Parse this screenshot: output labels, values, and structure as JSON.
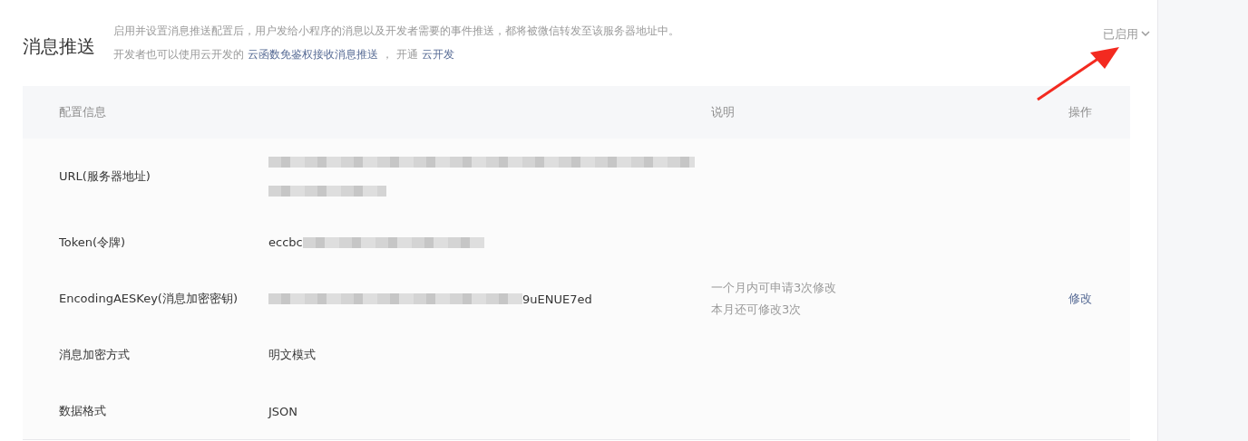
{
  "header": {
    "title": "消息推送",
    "description_line_1": "启用并设置消息推送配置后，用户发给小程序的消息以及开发者需要的事件推送，都将被微信转发至该服务器地址中。",
    "description_line_2": [
      {
        "kind": "text",
        "text": "开发者也可以使用云开发的"
      },
      {
        "kind": "link",
        "text": "云函数免鉴权接收消息推送"
      },
      {
        "kind": "text",
        "text": "， 开通"
      },
      {
        "kind": "link",
        "text": "云开发"
      }
    ],
    "status": "已启用"
  },
  "table": {
    "columns": [
      "配置信息",
      "说明",
      "操作"
    ],
    "rows": [
      {
        "label": "URL(服务器地址)",
        "value": [
          {
            "kind": "blur"
          },
          {
            "kind": "break"
          },
          {
            "kind": "blur"
          }
        ]
      },
      {
        "label": "Token(令牌)",
        "value": [
          {
            "kind": "text",
            "text": "eccbc"
          },
          {
            "kind": "blur"
          }
        ]
      },
      {
        "label": "EncodingAESKey(消息加密密钥)",
        "value": [
          {
            "kind": "blur"
          },
          {
            "kind": "text",
            "text": "9uENUE7ed"
          }
        ],
        "note": [
          "一个月内可申请3次修改",
          "本月还可修改3次"
        ],
        "action": "修改"
      },
      {
        "label": "消息加密方式",
        "value": [
          {
            "kind": "text",
            "text": "明文模式"
          }
        ]
      },
      {
        "label": "数据格式",
        "value": [
          {
            "kind": "text",
            "text": "JSON"
          }
        ]
      }
    ]
  }
}
